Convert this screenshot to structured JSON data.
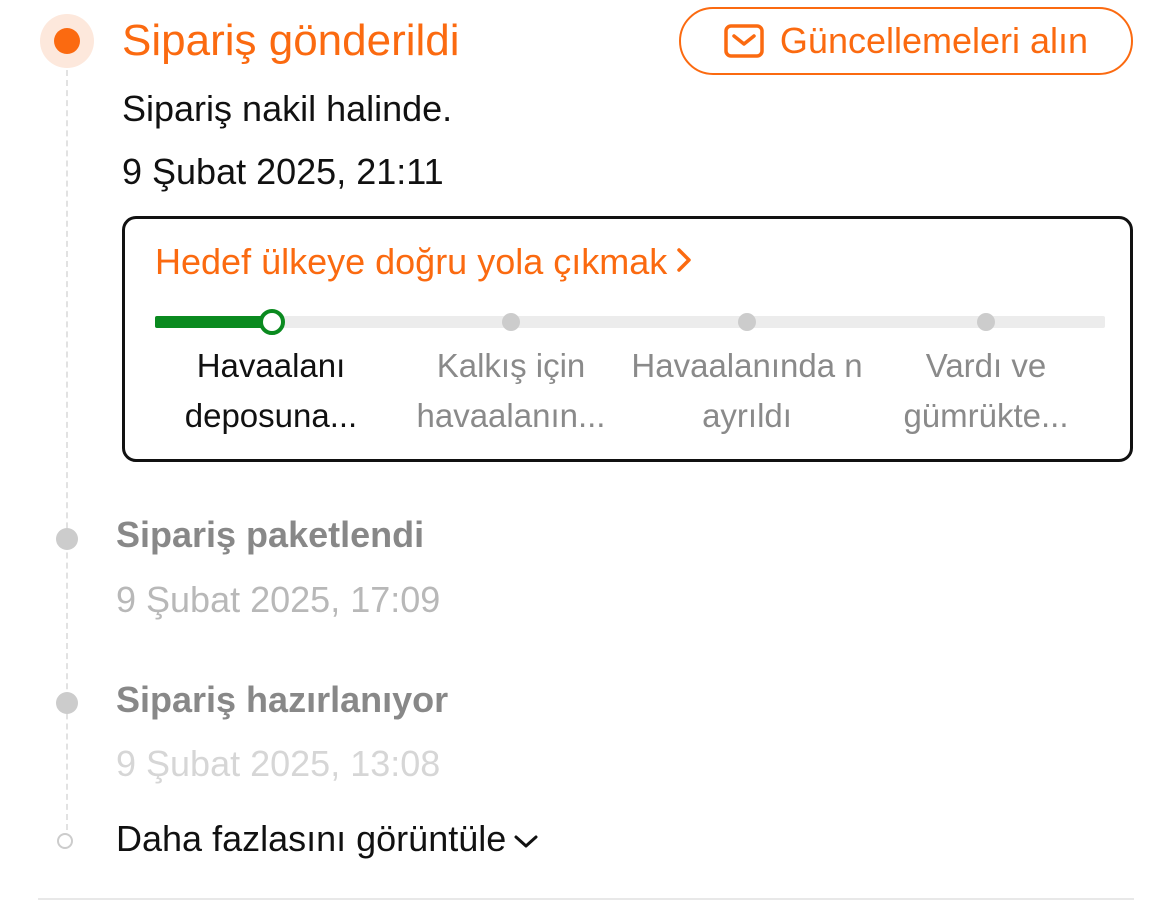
{
  "active_event": {
    "title": "Sipariş gönderildi",
    "description": "Sipariş nakil halinde.",
    "date": "9 Şubat 2025, 21:11"
  },
  "updates_button": {
    "label": "Güncellemeleri alın",
    "icon": "envelope-icon"
  },
  "shipping_progress": {
    "link_label": "Hedef ülkeye doğru yola çıkmak",
    "link_icon": "chevron-right-icon",
    "progress_fraction": 0.125,
    "current_step_index": 0,
    "steps": [
      {
        "label": "Havaalanı deposuna..."
      },
      {
        "label": "Kalkış için havaalanın..."
      },
      {
        "label": "Havaalanında n ayrıldı"
      },
      {
        "label": "Vardı ve gümrükte..."
      }
    ]
  },
  "past_events": [
    {
      "title": "Sipariş paketlendi",
      "date": "9 Şubat 2025, 17:09"
    },
    {
      "title": "Sipariş hazırlanıyor",
      "date": "9 Şubat 2025, 13:08"
    }
  ],
  "view_more": {
    "label": "Daha fazlasını görüntüle",
    "icon": "chevron-down-icon"
  },
  "colors": {
    "accent": "#fb6a10",
    "progress": "#0a8a1f",
    "muted_text": "#888888",
    "faded_text": "#b8b8b8"
  }
}
